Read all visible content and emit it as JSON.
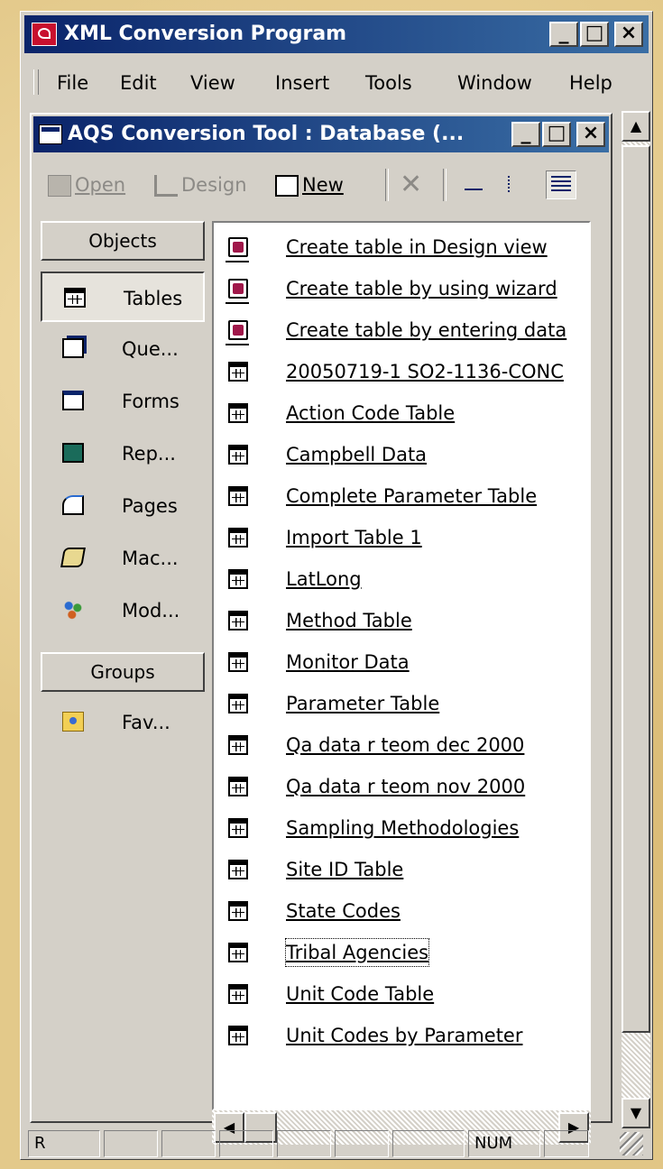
{
  "app": {
    "title": "XML Conversion Program"
  },
  "window_buttons": {
    "minimize": "_",
    "maximize": "□",
    "close": "×"
  },
  "menubar": [
    "File",
    "Edit",
    "View",
    "Insert",
    "Tools",
    "Window",
    "Help"
  ],
  "child": {
    "title": "AQS Conversion Tool : Database (..."
  },
  "toolbar": {
    "open": "Open",
    "design": "Design",
    "new": "New"
  },
  "objects": {
    "header": "Objects",
    "items": [
      {
        "label": "Tables",
        "icon": "table-icon"
      },
      {
        "label": "Que...",
        "icon": "query-icon"
      },
      {
        "label": "Forms",
        "icon": "form-icon"
      },
      {
        "label": "Rep...",
        "icon": "report-icon"
      },
      {
        "label": "Pages",
        "icon": "page-icon"
      },
      {
        "label": "Mac...",
        "icon": "macro-icon"
      },
      {
        "label": "Mod...",
        "icon": "module-icon"
      }
    ],
    "groups_header": "Groups",
    "groups": [
      {
        "label": "Fav...",
        "icon": "favorites-folder-icon"
      }
    ]
  },
  "list": [
    {
      "label": "Create table in Design view",
      "icon": "wizard-icon"
    },
    {
      "label": "Create table by using wizard",
      "icon": "wizard-icon"
    },
    {
      "label": "Create table by entering data",
      "icon": "wizard-icon"
    },
    {
      "label": "20050719-1  SO2-1136-CONC",
      "icon": "table-icon"
    },
    {
      "label": "Action Code Table",
      "icon": "table-icon"
    },
    {
      "label": "Campbell Data",
      "icon": "table-icon"
    },
    {
      "label": "Complete Parameter Table",
      "icon": "table-icon"
    },
    {
      "label": "Import Table 1",
      "icon": "table-icon"
    },
    {
      "label": "LatLong",
      "icon": "table-icon"
    },
    {
      "label": "Method Table",
      "icon": "table-icon"
    },
    {
      "label": "Monitor Data",
      "icon": "table-icon"
    },
    {
      "label": "Parameter Table",
      "icon": "table-icon"
    },
    {
      "label": "Qa data r teom dec 2000",
      "icon": "table-icon"
    },
    {
      "label": "Qa data r teom nov 2000",
      "icon": "table-icon"
    },
    {
      "label": "Sampling Methodologies",
      "icon": "table-icon"
    },
    {
      "label": "Site ID Table",
      "icon": "table-icon"
    },
    {
      "label": "State Codes",
      "icon": "table-icon"
    },
    {
      "label": "Tribal Agencies",
      "icon": "table-icon"
    },
    {
      "label": "Unit Code Table",
      "icon": "table-icon"
    },
    {
      "label": "Unit Codes by Parameter",
      "icon": "table-icon"
    }
  ],
  "focused_item": "Tribal Agencies",
  "status": {
    "left": "R",
    "num": "NUM"
  }
}
